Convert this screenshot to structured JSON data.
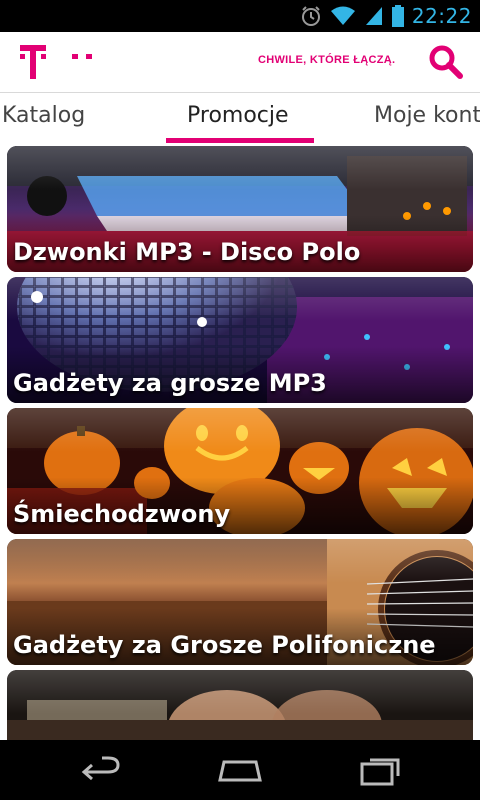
{
  "status_bar": {
    "time": "22:22",
    "icons": [
      "alarm-icon",
      "wifi-icon",
      "signal-icon",
      "battery-icon"
    ],
    "color": "#33b5e5"
  },
  "header": {
    "logo": "T · ·",
    "slogan": "CHWILE, KTÓRE ŁĄCZĄ.",
    "brand_color": "#e20074"
  },
  "tabs": [
    {
      "label": "Katalog",
      "active": false
    },
    {
      "label": "Promocje",
      "active": true
    },
    {
      "label": "Moje kont",
      "active": false
    }
  ],
  "promos": [
    {
      "title": "Dzwonki MP3 - Disco Polo",
      "image": "disco-dance-floor"
    },
    {
      "title": "Gadżety za grosze MP3",
      "image": "disco-ball"
    },
    {
      "title": "Śmiechodzwony",
      "image": "halloween-pumpkins"
    },
    {
      "title": "Gadżety za Grosze Polifoniczne",
      "image": "acoustic-guitar"
    },
    {
      "title": "",
      "image": "guitarist"
    }
  ],
  "nav_bar": {
    "buttons": [
      "back-icon",
      "home-icon",
      "recent-apps-icon"
    ]
  }
}
